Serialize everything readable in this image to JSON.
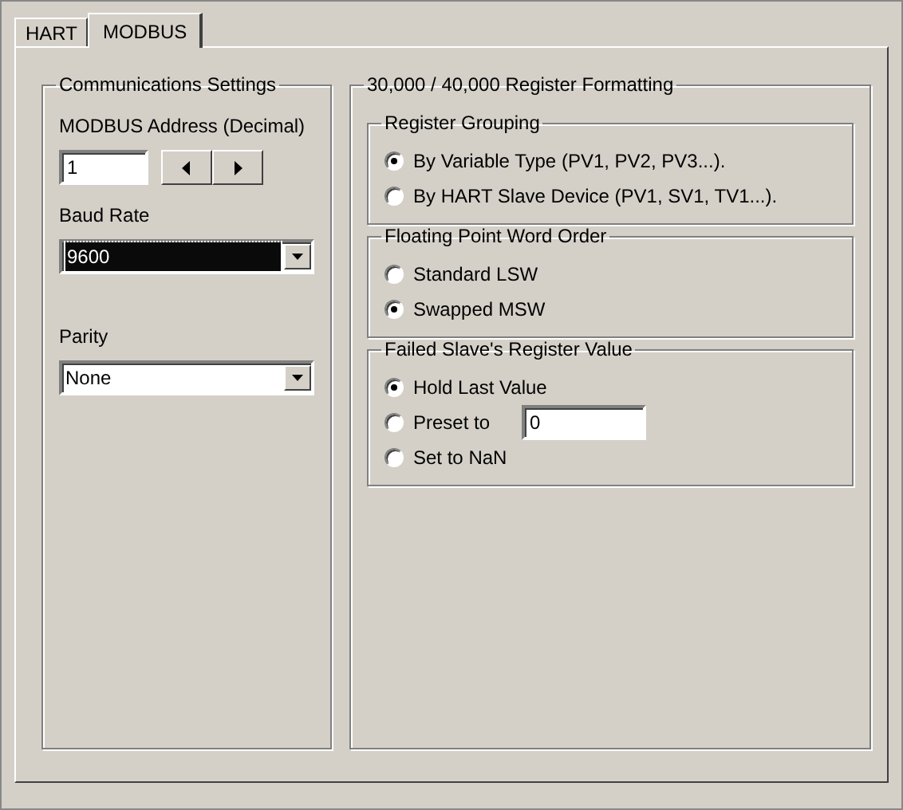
{
  "tabs": [
    {
      "label": "HART",
      "selected": false
    },
    {
      "label": "MODBUS",
      "selected": true
    }
  ],
  "communications": {
    "title": "Communications Settings",
    "fields": [
      {
        "kind": "spin",
        "label": "MODBUS Address (Decimal)",
        "value": "1"
      },
      {
        "kind": "combo",
        "label": "Baud Rate",
        "value": "9600",
        "focused": true
      },
      {
        "kind": "combo",
        "label": "Parity",
        "value": "None",
        "focused": false
      }
    ]
  },
  "formatting": {
    "title": "30,000 / 40,000 Register Formatting",
    "groups": [
      {
        "title": "Register Grouping",
        "options": [
          {
            "label": "By Variable Type (PV1, PV2, PV3...).",
            "selected": true
          },
          {
            "label": "By HART Slave Device (PV1, SV1, TV1...).",
            "selected": false
          }
        ]
      },
      {
        "title": "Floating Point Word Order",
        "options": [
          {
            "label": "Standard LSW",
            "selected": false
          },
          {
            "label": "Swapped MSW",
            "selected": true
          }
        ]
      },
      {
        "title": "Failed Slave's Register Value",
        "options": [
          {
            "label": "Hold Last Value",
            "selected": true
          },
          {
            "label": "Preset to",
            "selected": false,
            "field": "0"
          },
          {
            "label": "Set to NaN",
            "selected": false
          }
        ]
      }
    ]
  }
}
